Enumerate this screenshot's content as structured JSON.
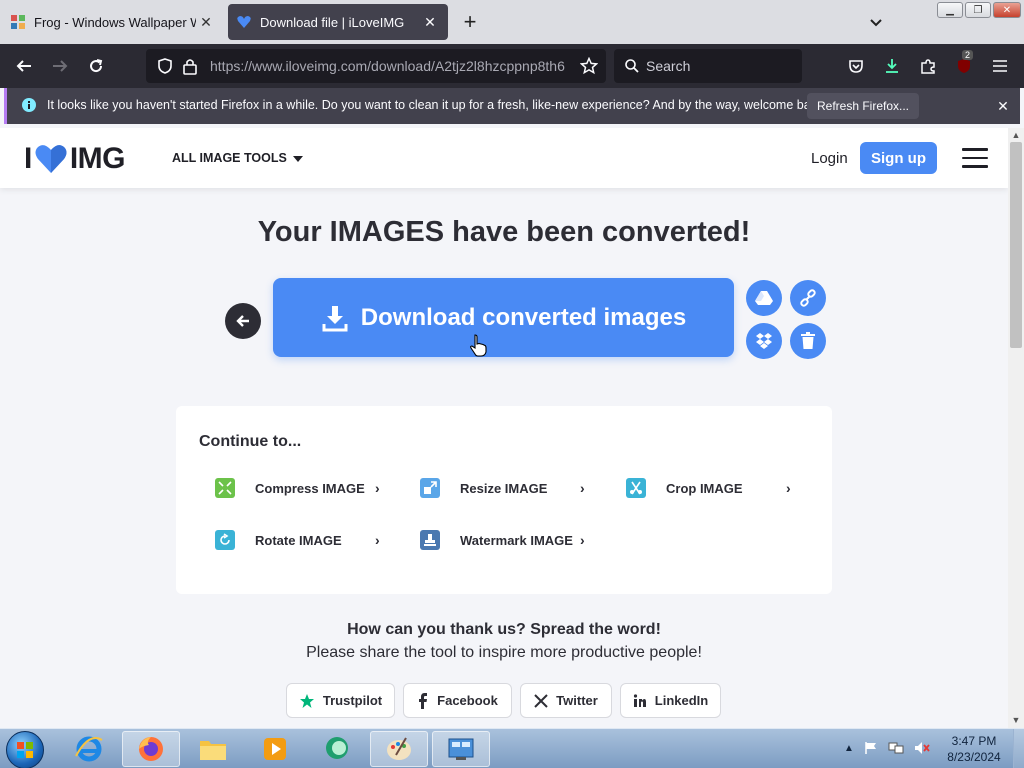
{
  "browser": {
    "tabs": [
      {
        "label": "Frog - Windows Wallpaper Wiki",
        "active": false
      },
      {
        "label": "Download file | iLoveIMG",
        "active": true
      }
    ],
    "url_host": "https://www.iloveimg.com",
    "url_path": "/download/A2tjz2l8hzcppnp8th6",
    "search_placeholder": "Search",
    "extension_badge": "2",
    "notification": {
      "text": "It looks like you haven't started Firefox in a while. Do you want to clean it up for a fresh, like-new experience? And by the way, welcome back!",
      "button": "Refresh Firefox..."
    }
  },
  "site": {
    "logo_left": "I",
    "logo_right": "IMG",
    "all_tools": "ALL IMAGE TOOLS",
    "login": "Login",
    "signup": "Sign up",
    "accent_color": "#4a8af4"
  },
  "main": {
    "headline": "Your IMAGES have been converted!",
    "download_button": "Download converted images",
    "side_actions": [
      "google-drive",
      "copy-link",
      "dropbox",
      "delete"
    ],
    "continue": {
      "title": "Continue to...",
      "tools": [
        {
          "label": "Compress IMAGE",
          "icon": "compress-icon",
          "color": "#6cc24a"
        },
        {
          "label": "Resize IMAGE",
          "icon": "resize-icon",
          "color": "#5aa6e8"
        },
        {
          "label": "Crop IMAGE",
          "icon": "crop-icon",
          "color": "#3ab3d6"
        },
        {
          "label": "Rotate IMAGE",
          "icon": "rotate-icon",
          "color": "#3ab3d6"
        },
        {
          "label": "Watermark IMAGE",
          "icon": "watermark-icon",
          "color": "#4a78b0"
        }
      ]
    },
    "thanks": "How can you thank us? Spread the word!",
    "share_text": "Please share the tool to inspire more productive people!",
    "share_buttons": [
      "Trustpilot",
      "Facebook",
      "Twitter",
      "LinkedIn"
    ]
  },
  "taskbar": {
    "time": "3:47 PM",
    "date": "8/23/2024"
  }
}
